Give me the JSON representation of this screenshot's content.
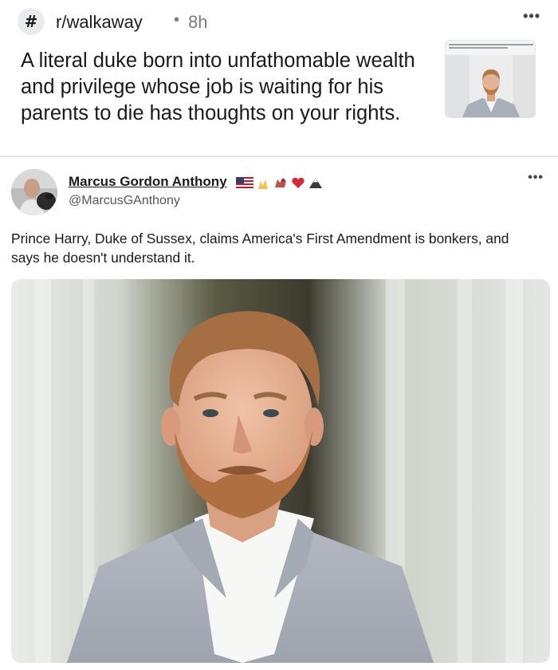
{
  "post": {
    "subreddit_icon_glyph": "#",
    "subreddit": "r/walkaway",
    "separator": "•",
    "age": "8h",
    "more_glyph": "•••",
    "title": "A literal duke born into unfathomable wealth and privilege whose job is waiting for his parents to die has thoughts on your rights."
  },
  "tweet": {
    "author_name": "Marcus Gordon Anthony",
    "author_emojis": [
      "us-flag",
      "hands",
      "dog",
      "heart",
      "mountain"
    ],
    "handle": "@MarcusGAnthony",
    "more_glyph": "•••",
    "text": "Prince Harry, Duke of Sussex, claims America's First Amendment is bonkers, and says he doesn't understand it.",
    "image": "photo of a bearded man in a grey blazer"
  },
  "colors": {
    "text": "#1a1a1b",
    "muted": "#7c7c7c",
    "divider": "#e6e6e6"
  }
}
